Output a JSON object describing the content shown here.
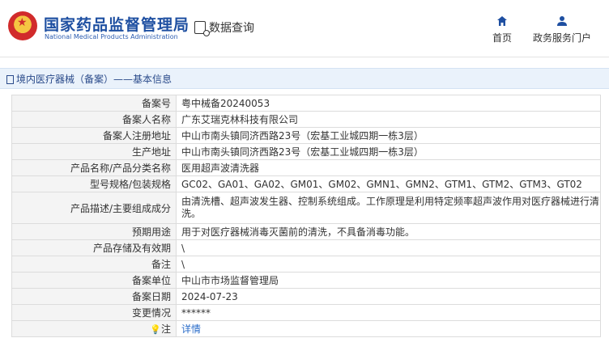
{
  "header": {
    "brand_cn": "国家药品监督管理局",
    "brand_en": "National Medical Products Administration",
    "query_label": "数据查询",
    "nav": [
      {
        "label": "首页",
        "icon": "home-icon"
      },
      {
        "label": "政务服务门户",
        "icon": "user-icon"
      }
    ]
  },
  "breadcrumb": "境内医疗器械（备案）——基本信息",
  "rows": [
    {
      "label": "备案号",
      "value": "粤中械备20240053"
    },
    {
      "label": "备案人名称",
      "value": "广东艾瑞克林科技有限公司"
    },
    {
      "label": "备案人注册地址",
      "value": "中山市南头镇同济西路23号（宏基工业城四期一栋3层）"
    },
    {
      "label": "生产地址",
      "value": "中山市南头镇同济西路23号（宏基工业城四期一栋3层）"
    },
    {
      "label": "产品名称/产品分类名称",
      "value": "医用超声波清洗器"
    },
    {
      "label": "型号规格/包装规格",
      "value": "GC02、GA01、GA02、GM01、GM02、GMN1、GMN2、GTM1、GTM2、GTM3、GT02"
    },
    {
      "label": "产品描述/主要组成成分",
      "value": "由清洗槽、超声波发生器、控制系统组成。工作原理是利用特定频率超声波作用对医疗器械进行清洗。"
    },
    {
      "label": "预期用途",
      "value": "用于对医疗器械消毒灭菌前的清洗，不具备消毒功能。"
    },
    {
      "label": "产品存储及有效期",
      "value": "\\"
    },
    {
      "label": "备注",
      "value": "\\"
    },
    {
      "label": "备案单位",
      "value": "中山市市场监督管理局"
    },
    {
      "label": "备案日期",
      "value": "2024-07-23"
    },
    {
      "label": "变更情况",
      "value": "******"
    },
    {
      "label": "注",
      "value": "详情"
    }
  ],
  "colors": {
    "brand": "#1e4fa1",
    "link": "#2a6cc9",
    "bar": "#eaf2fb"
  }
}
